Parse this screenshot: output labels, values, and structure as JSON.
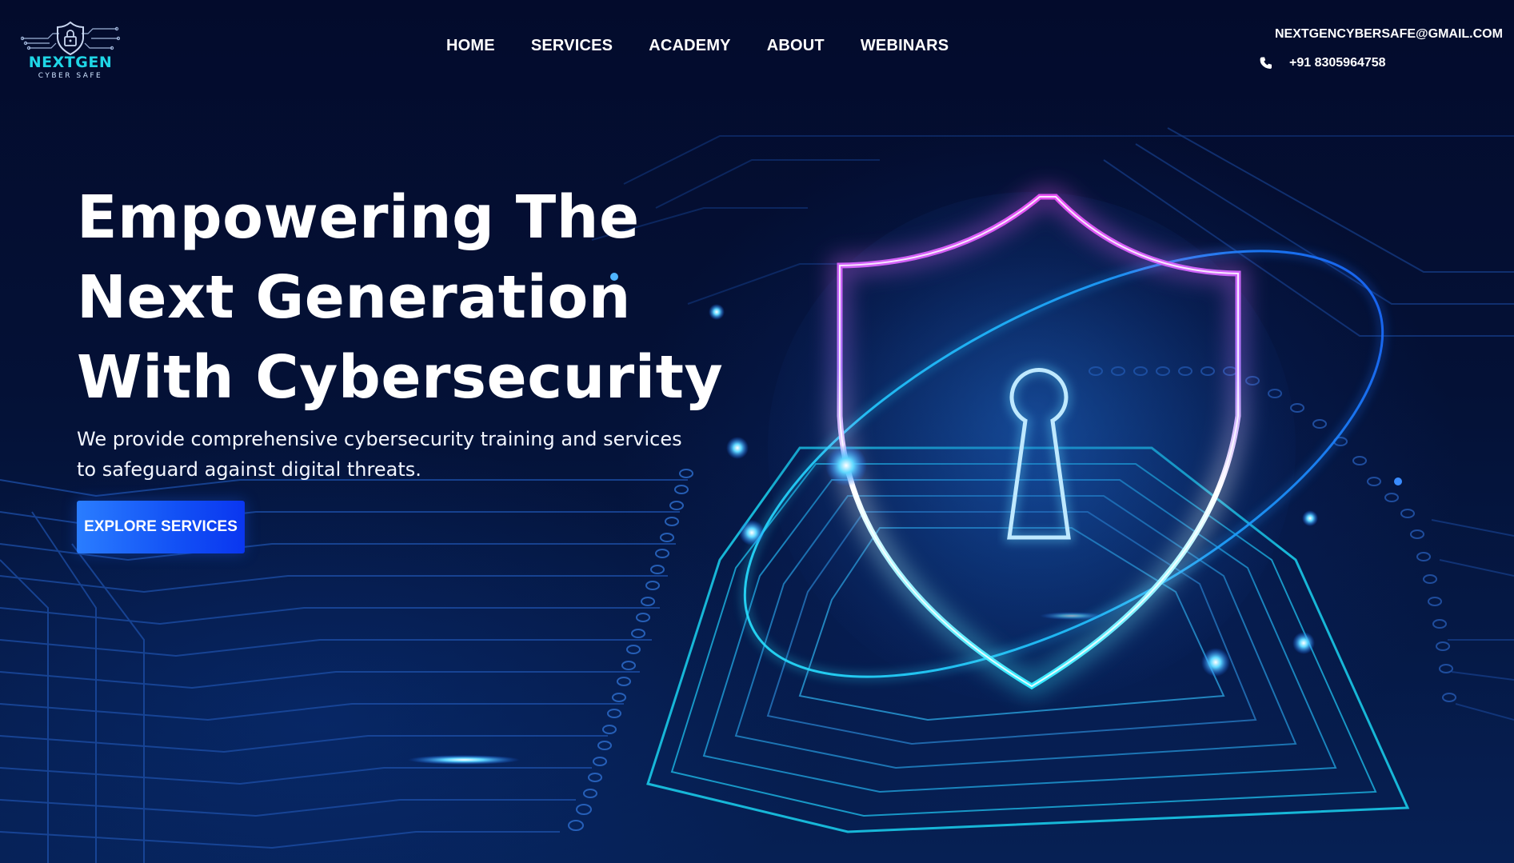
{
  "brand": {
    "name": "NEXTGEN",
    "tagline": "CYBER SAFE",
    "logo_icon": "shield-lock-icon",
    "accent_color": "#1fd6e6"
  },
  "nav": {
    "items": [
      {
        "label": "HOME"
      },
      {
        "label": "SERVICES"
      },
      {
        "label": "ACADEMY"
      },
      {
        "label": "ABOUT"
      },
      {
        "label": "WEBINARS"
      }
    ]
  },
  "contact": {
    "email": "NEXTGENCYBERSAFE@GMAIL.COM",
    "email_icon": "envelope-icon",
    "phone": "+91 8305964758",
    "phone_icon": "phone-icon"
  },
  "hero": {
    "title_lines": [
      "Empowering The",
      "Next Generation",
      "With Cybersecurity"
    ],
    "description": "We provide comprehensive cybersecurity training and services to safeguard against digital threats.",
    "cta_label": "EXPLORE SERVICES",
    "illustration_icon": "shield-keyhole-icon"
  },
  "colors": {
    "background": "#030b2c",
    "cta": "#1250f5",
    "shield_glow_top": "#e04cf0",
    "shield_glow_bottom": "#2ee6ff"
  }
}
